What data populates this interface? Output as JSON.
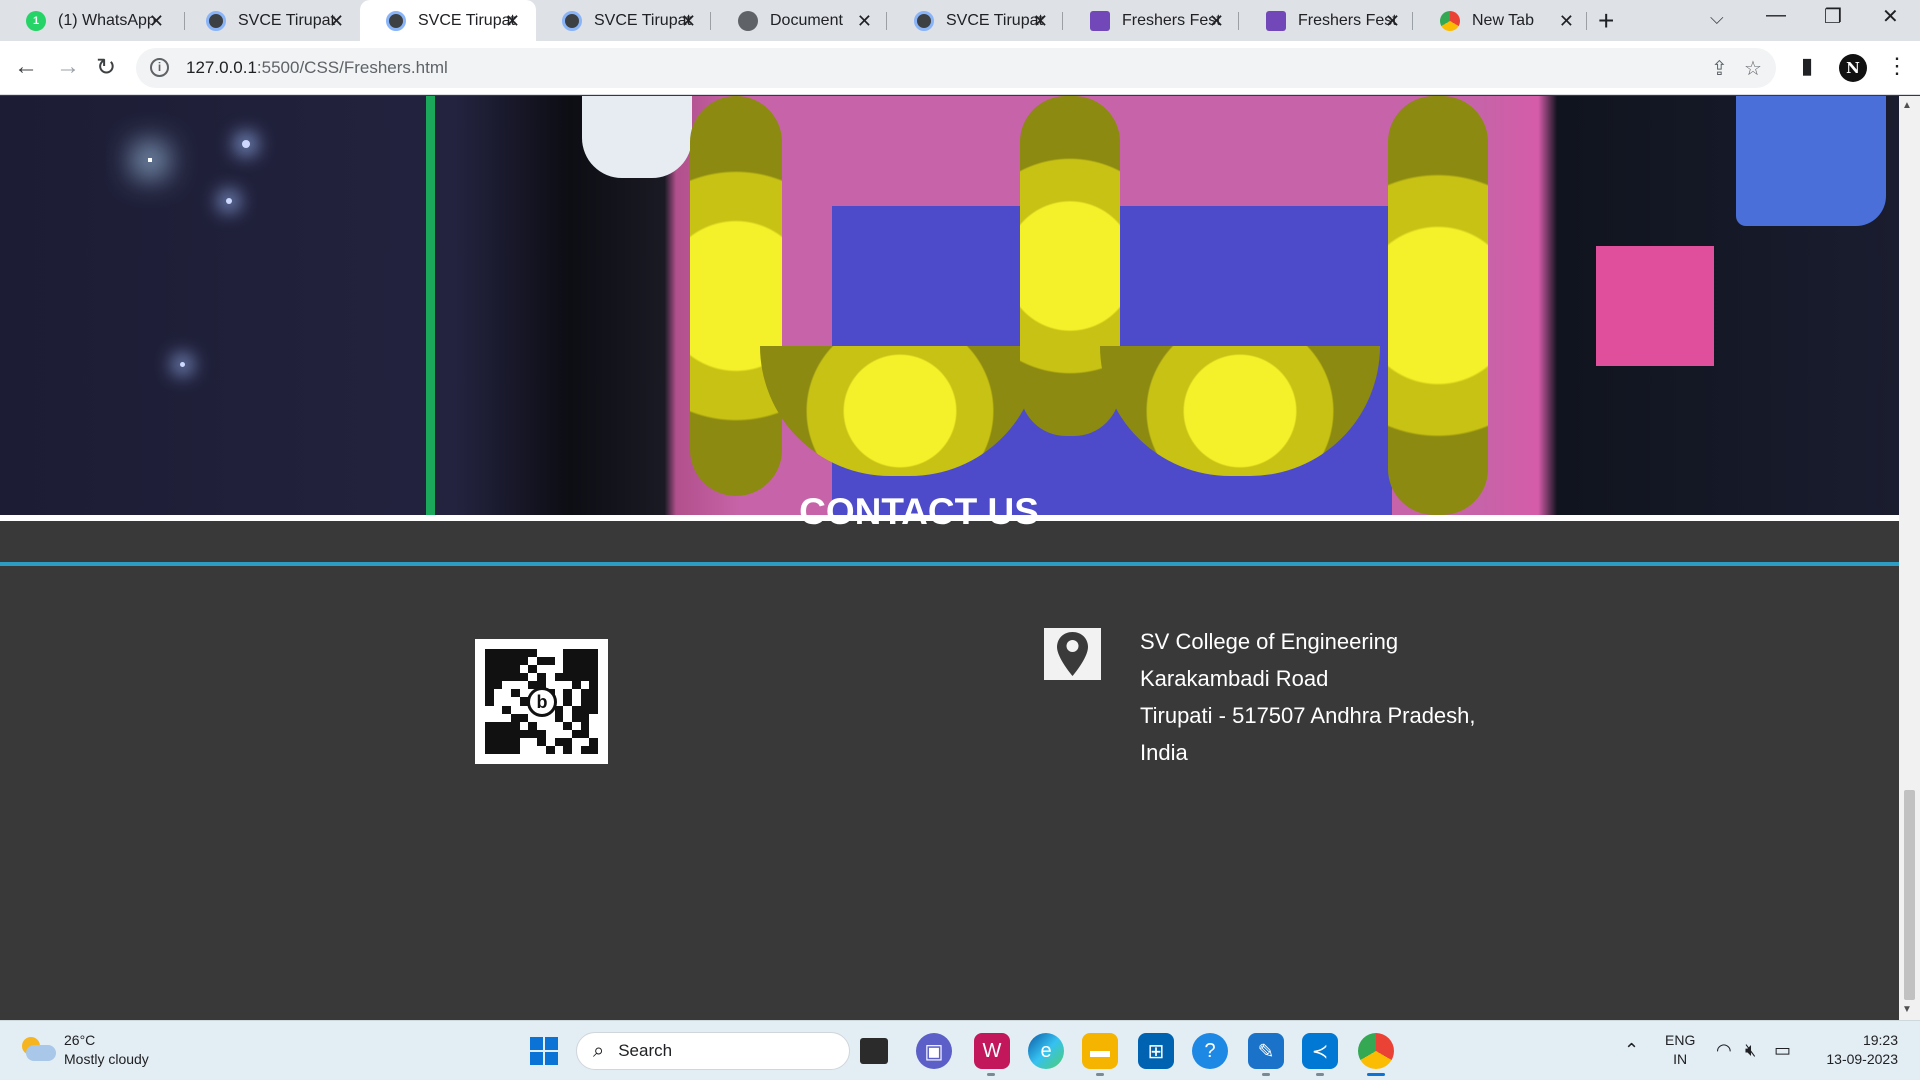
{
  "browser": {
    "tabs": [
      {
        "title": "(1) WhatsApp",
        "favicon": "whatsapp-icon",
        "badge": "1",
        "active": false
      },
      {
        "title": "SVCE Tirupati",
        "favicon": "svce-icon",
        "active": false
      },
      {
        "title": "SVCE Tirupati",
        "favicon": "svce-icon",
        "active": true
      },
      {
        "title": "SVCE Tirupati",
        "favicon": "svce-icon",
        "active": false
      },
      {
        "title": "Document",
        "favicon": "globe-icon",
        "active": false
      },
      {
        "title": "SVCE Tirupati",
        "favicon": "svce-icon",
        "active": false
      },
      {
        "title": "Freshers Fest I",
        "favicon": "google-forms-icon",
        "active": false
      },
      {
        "title": "Freshers Fest I",
        "favicon": "google-forms-icon",
        "active": false
      },
      {
        "title": "New Tab",
        "favicon": "chrome-icon",
        "active": false
      }
    ],
    "url_host": "127.0.0.1",
    "url_path": ":5500/CSS/Freshers.html",
    "profile_initial": "N"
  },
  "page": {
    "contact_title": "CONTACT US",
    "address_lines": [
      "SV College of Engineering",
      "Karakambadi Road",
      "Tirupati - 517507 Andhra Pradesh,",
      "India"
    ],
    "qr_center_letter": "b"
  },
  "taskbar": {
    "weather_temp": "26°C",
    "weather_desc": "Mostly cloudy",
    "search_label": "Search",
    "lang_top": "ENG",
    "lang_bottom": "IN",
    "time": "19:23",
    "date": "13-09-2023"
  },
  "colors": {
    "page_bg": "#393939",
    "accent_rule": "#2e9dc3",
    "taskbar_bg": "#e3eef4"
  }
}
